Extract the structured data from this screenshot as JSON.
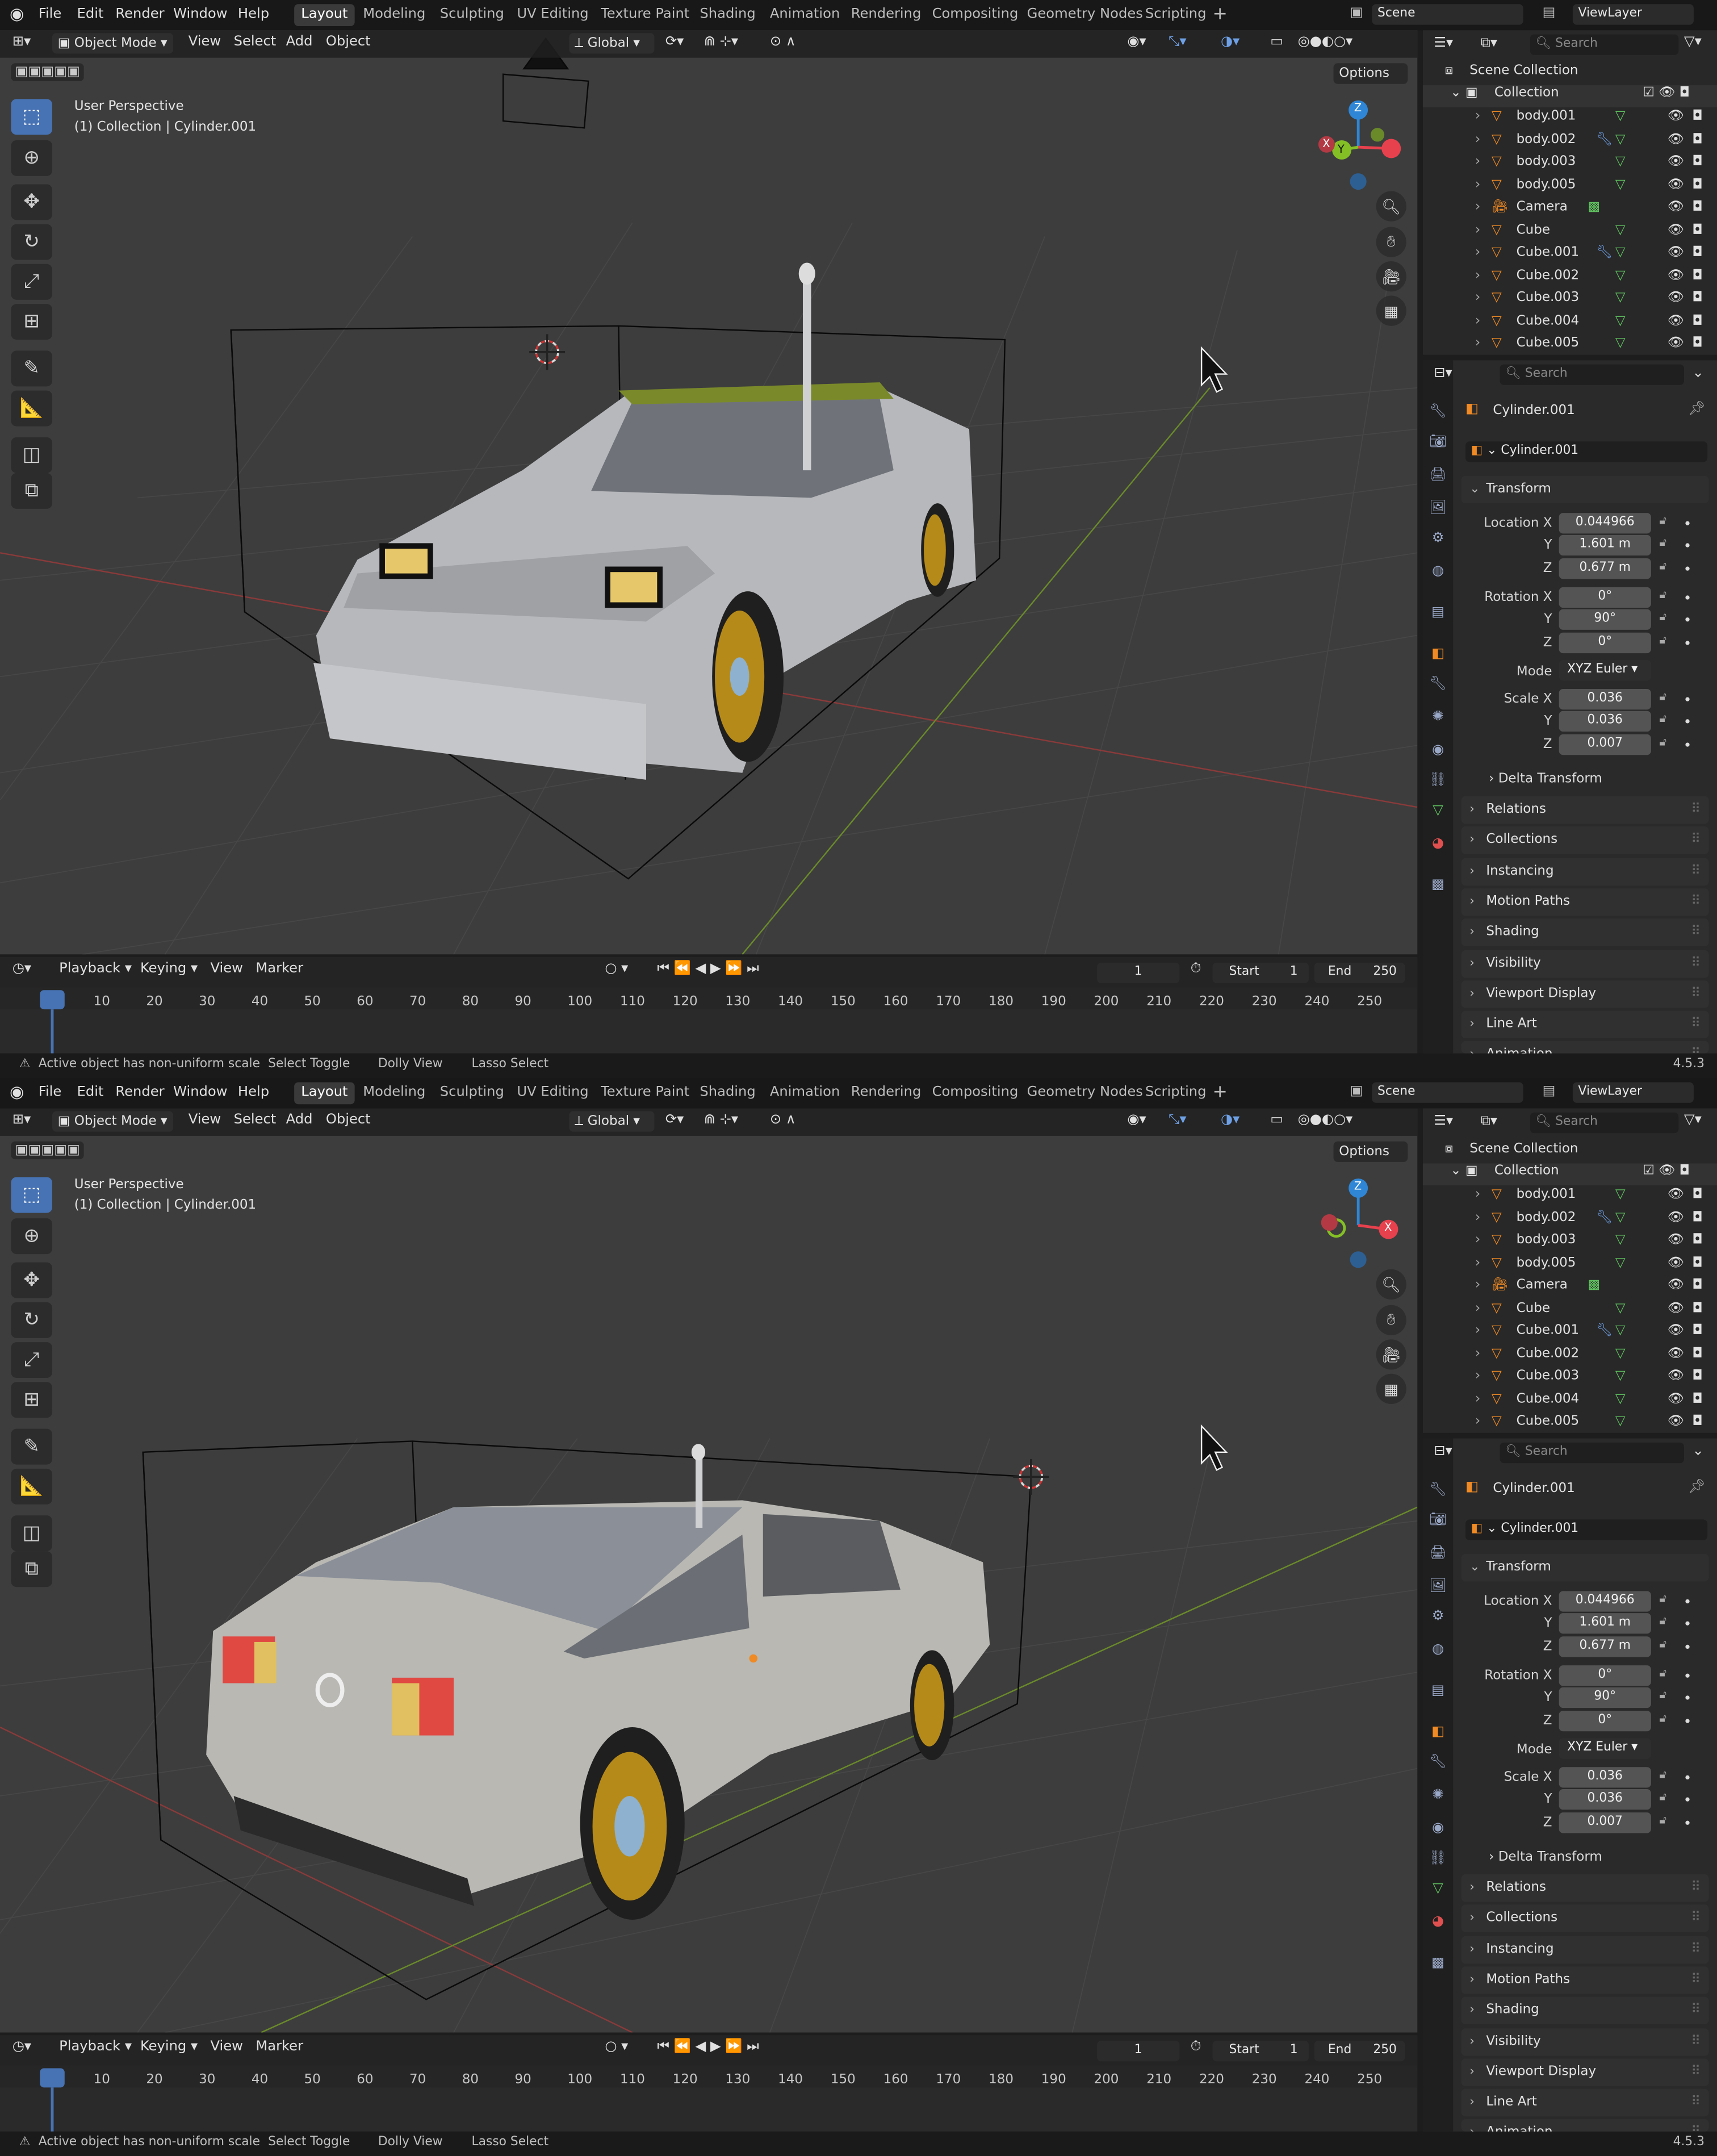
{
  "menus": [
    "File",
    "Edit",
    "Render",
    "Window",
    "Help"
  ],
  "workspaces": [
    "Layout",
    "Modeling",
    "Sculpting",
    "UV Editing",
    "Texture Paint",
    "Shading",
    "Animation",
    "Rendering",
    "Compositing",
    "Geometry Nodes",
    "Scripting"
  ],
  "active_workspace": "Layout",
  "scene": "Scene",
  "view_layer": "ViewLayer",
  "viewport": {
    "mode": "Object Mode",
    "menu": [
      "View",
      "Select",
      "Add",
      "Object"
    ],
    "orientation": "Global",
    "options": "Options",
    "perspective": "User Perspective",
    "context": "(1) Collection | Cylinder.001"
  },
  "gizmo": {
    "x": "X",
    "y": "Y",
    "z": "Z"
  },
  "timeline": {
    "menu": [
      "Playback",
      "Keying",
      "View",
      "Marker"
    ],
    "current": "1",
    "start_label": "Start",
    "start": "1",
    "end_label": "End",
    "end": "250",
    "ticks": [
      "1",
      "10",
      "20",
      "30",
      "40",
      "50",
      "60",
      "70",
      "80",
      "90",
      "100",
      "110",
      "120",
      "130",
      "140",
      "150",
      "160",
      "170",
      "180",
      "190",
      "200",
      "210",
      "220",
      "230",
      "240",
      "250"
    ]
  },
  "status": {
    "message": "Active object has non-uniform scale",
    "hints": [
      "Select Toggle",
      "Dolly View",
      "Lasso Select"
    ],
    "version": "4.5.3"
  },
  "outliner": {
    "search": "Search",
    "root": "Scene Collection",
    "collection": "Collection",
    "items": [
      "body.001",
      "body.002",
      "body.003",
      "body.005",
      "Camera",
      "Cube",
      "Cube.001",
      "Cube.002",
      "Cube.003",
      "Cube.004",
      "Cube.005"
    ]
  },
  "properties": {
    "search": "Search",
    "object": "Cylinder.001",
    "data": "Cylinder.001",
    "transform": "Transform",
    "location_label": "Location X",
    "rotation_label": "Rotation X",
    "scale_label": "Scale X",
    "y": "Y",
    "z": "Z",
    "location": [
      "0.044966",
      "1.601 m",
      "0.677 m"
    ],
    "rotation": [
      "0°",
      "90°",
      "0°"
    ],
    "mode_label": "Mode",
    "mode": "XYZ Euler",
    "scale": [
      "0.036",
      "0.036",
      "0.007"
    ],
    "delta": "Delta Transform",
    "sections": [
      "Relations",
      "Collections",
      "Instancing",
      "Motion Paths",
      "Shading",
      "Visibility",
      "Viewport Display",
      "Line Art",
      "Animation"
    ]
  },
  "colors": {
    "accent": "#4772b3",
    "x_axis": "#e8414e",
    "y_axis": "#84c025",
    "z_axis": "#2f86d6",
    "orange": "#f08a24"
  }
}
